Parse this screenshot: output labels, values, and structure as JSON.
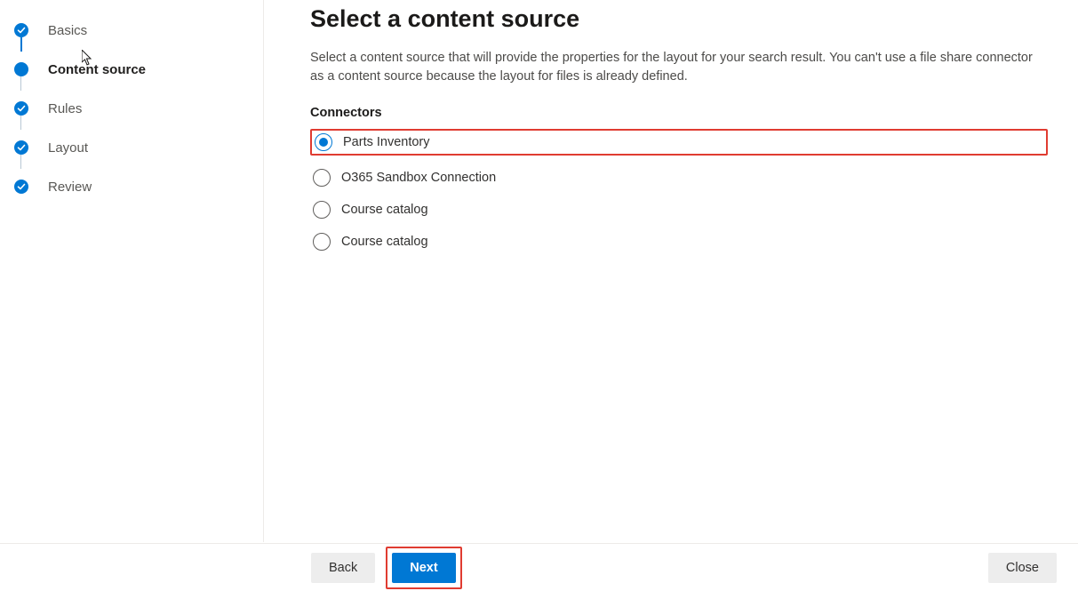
{
  "sidebar": {
    "steps": [
      {
        "label": "Basics",
        "state": "completed"
      },
      {
        "label": "Content source",
        "state": "current"
      },
      {
        "label": "Rules",
        "state": "completed"
      },
      {
        "label": "Layout",
        "state": "completed"
      },
      {
        "label": "Review",
        "state": "completed"
      }
    ]
  },
  "main": {
    "title": "Select a content source",
    "description": "Select a content source that will provide the properties for the layout for your search result. You can't use a file share connector as a content source because the layout for files is already defined.",
    "group_label": "Connectors",
    "options": [
      {
        "label": "Parts Inventory",
        "selected": true,
        "highlighted": true
      },
      {
        "label": "O365 Sandbox Connection",
        "selected": false,
        "highlighted": false
      },
      {
        "label": "Course catalog",
        "selected": false,
        "highlighted": false
      },
      {
        "label": "Course catalog",
        "selected": false,
        "highlighted": false
      }
    ]
  },
  "footer": {
    "back_label": "Back",
    "next_label": "Next",
    "close_label": "Close",
    "next_highlighted": true
  },
  "colors": {
    "primary": "#0078d4",
    "highlight_border": "#e03c31"
  }
}
